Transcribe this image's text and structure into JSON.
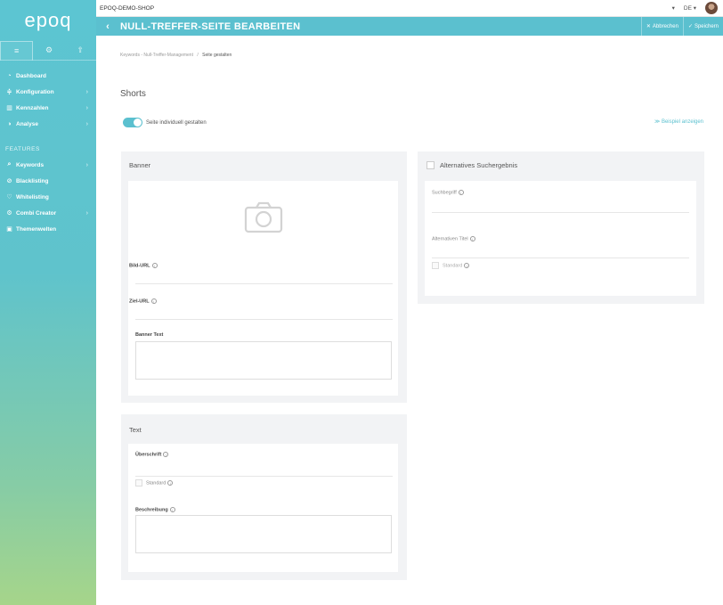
{
  "sidebar": {
    "logo": "epoq",
    "tabs": [
      {
        "icon": "menu-icon",
        "glyph": "≡"
      },
      {
        "icon": "gear-icon",
        "glyph": "⚙"
      },
      {
        "icon": "upload-icon",
        "glyph": "⇪"
      }
    ],
    "items": [
      {
        "label": "Dashboard",
        "glyph": "◔",
        "icon": "dashboard-icon"
      },
      {
        "label": "Konfiguration",
        "glyph": "≑",
        "icon": "sliders-icon"
      },
      {
        "label": "Kennzahlen",
        "glyph": "▥",
        "icon": "chart-icon"
      },
      {
        "label": "Analyse",
        "glyph": "◑",
        "icon": "pie-icon"
      }
    ],
    "features_label": "FEATURES",
    "features": [
      {
        "label": "Keywords",
        "glyph": "⌕",
        "icon": "search-icon"
      },
      {
        "label": "Blacklisting",
        "glyph": "⊘",
        "icon": "ban-icon"
      },
      {
        "label": "Whitelisting",
        "glyph": "♡",
        "icon": "heart-icon"
      },
      {
        "label": "Combi Creator",
        "glyph": "⚙",
        "icon": "cog-icon"
      },
      {
        "label": "Themenwelten",
        "glyph": "▣",
        "icon": "image-icon"
      }
    ]
  },
  "topbar": {
    "shop_name": "EPOQ-DEMO-SHOP",
    "language": "DE"
  },
  "titlebar": {
    "title": "NULL-TREFFER-SEITE BEARBEITEN",
    "cancel_label": "Abbrechen",
    "save_label": "Speichern"
  },
  "main": {
    "breadcrumb_parent": "Keywords - Null-Treffer-Management",
    "breadcrumb_sep": "/",
    "breadcrumb_current": "Seite gestalten",
    "heading": "Shorts",
    "toggle_label": "Seite individuell gestalten",
    "toggle_on": true,
    "example_link": "≫ Beispiel anzeigen",
    "banner": {
      "title": "Banner",
      "image_url_label": "Bild-URL",
      "target_url_label": "Ziel-URL",
      "banner_text_label": "Banner Text"
    },
    "text": {
      "title": "Text",
      "heading_label": "Überschrift",
      "standard_label": "Standard",
      "description_label": "Beschreibung"
    },
    "alt": {
      "title": "Alternatives Suchergebnis",
      "search_term_label": "Suchbegriff",
      "alt_title_label": "Alternativen Titel",
      "standard_label": "Standard"
    }
  },
  "colors": {
    "accent": "#5bc0cf",
    "panel_bg": "#f2f3f5"
  }
}
